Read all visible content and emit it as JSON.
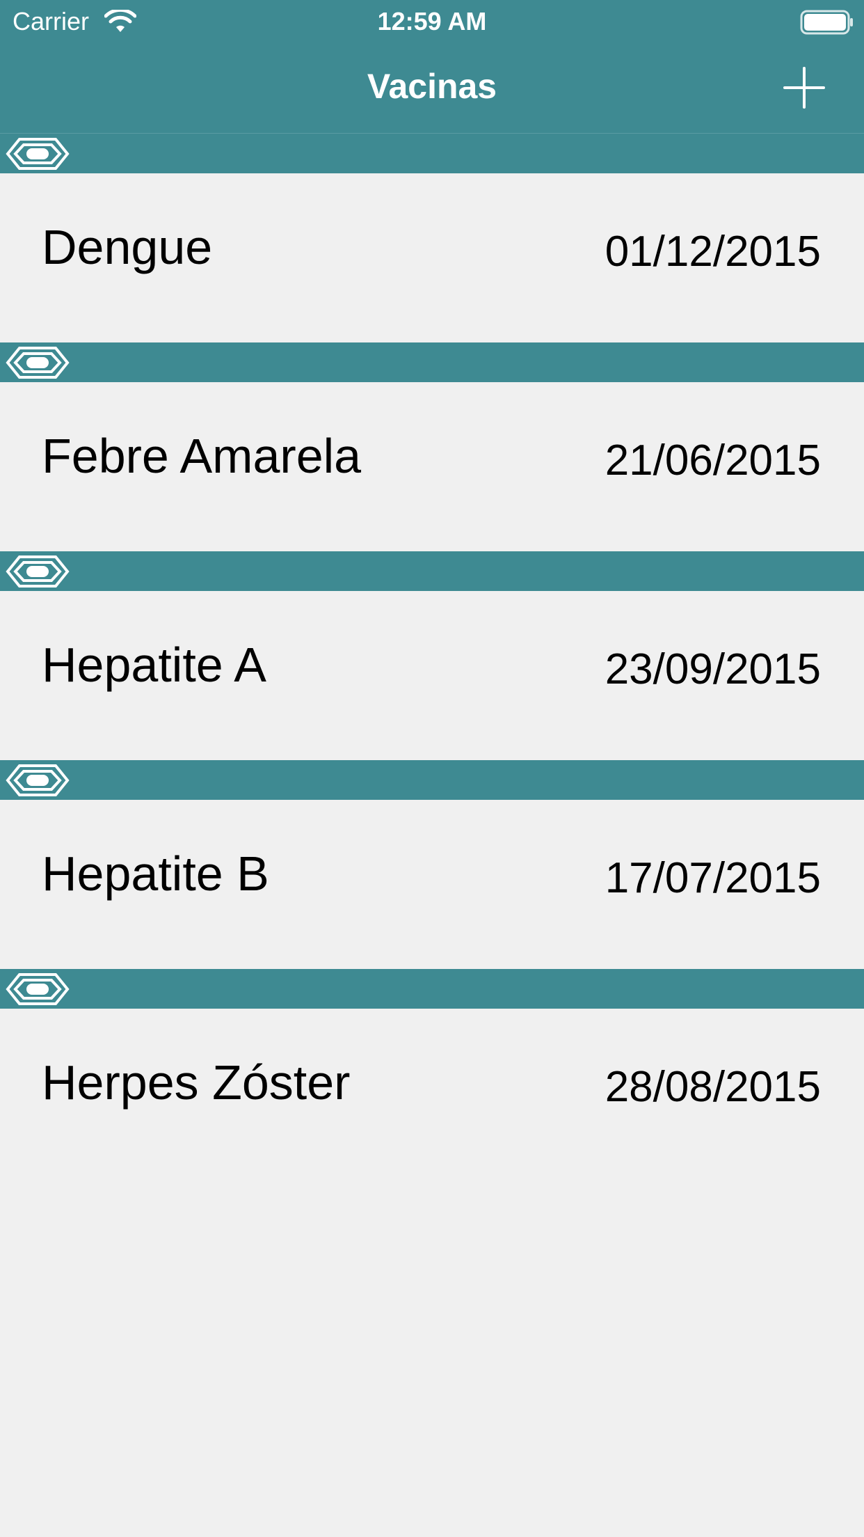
{
  "colors": {
    "brand": "#3e8a92",
    "background": "#f0f0f0",
    "text": "#000000",
    "bar_text": "#ffffff"
  },
  "status_bar": {
    "carrier": "Carrier",
    "time": "12:59 AM",
    "wifi_icon": "wifi-icon",
    "battery_icon": "battery-icon"
  },
  "nav": {
    "title": "Vacinas",
    "add_icon": "plus-icon"
  },
  "vaccines": [
    {
      "name": "Dengue",
      "date": "01/12/2015"
    },
    {
      "name": "Febre Amarela",
      "date": "21/06/2015"
    },
    {
      "name": "Hepatite A",
      "date": "23/09/2015"
    },
    {
      "name": "Hepatite B",
      "date": "17/07/2015"
    },
    {
      "name": "Herpes Zóster",
      "date": "28/08/2015"
    }
  ]
}
